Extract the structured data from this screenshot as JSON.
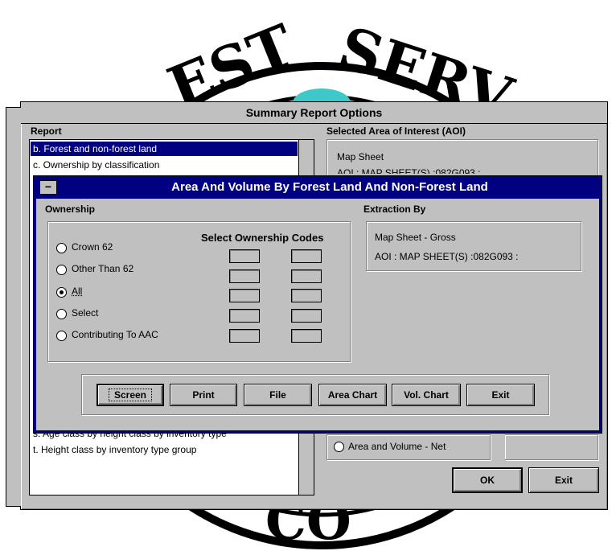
{
  "emblem": {
    "top_text": "EST SERV",
    "bottom_text": "CO"
  },
  "outer_window": {
    "title": "Summary Report Options",
    "report_label": "Report",
    "report_items": [
      "b. Forest and non-forest land",
      "c. Ownership by classification"
    ],
    "report_items_lower": [
      "s. Age class by height class by inventory type",
      "t. Height class by inventory type group"
    ],
    "aoi_label": "Selected Area of Interest (AOI)",
    "aoi_map_sheet": "Map Sheet",
    "aoi_partial": "AOI : MAP SHEET(S) :082G093 :",
    "radio_area_volume_net": "Area and Volume - Net",
    "ok_label": "OK",
    "exit_label": "Exit"
  },
  "dialog": {
    "sysmenu_glyph": "−",
    "title": "Area And Volume By Forest Land And Non-Forest Land",
    "ownership_label": "Ownership",
    "select_codes_label": "Select Ownership Codes",
    "options": [
      {
        "label": "Crown 62",
        "selected": false
      },
      {
        "label": "Other Than 62",
        "selected": false
      },
      {
        "label": "All",
        "selected": true
      },
      {
        "label": "Select",
        "selected": false
      },
      {
        "label": "Contributing To AAC",
        "selected": false
      }
    ],
    "extraction_label": "Extraction By",
    "extraction_line1": "Map Sheet - Gross",
    "extraction_line2": "AOI : MAP SHEET(S) :082G093 :",
    "buttons": {
      "screen": "Screen",
      "print": "Print",
      "file": "File",
      "area_chart": "Area Chart",
      "vol_chart": "Vol. Chart",
      "exit": "Exit"
    }
  },
  "colors": {
    "title_bar": "#000080",
    "face": "#c0c0c0",
    "selection": "#000080"
  }
}
